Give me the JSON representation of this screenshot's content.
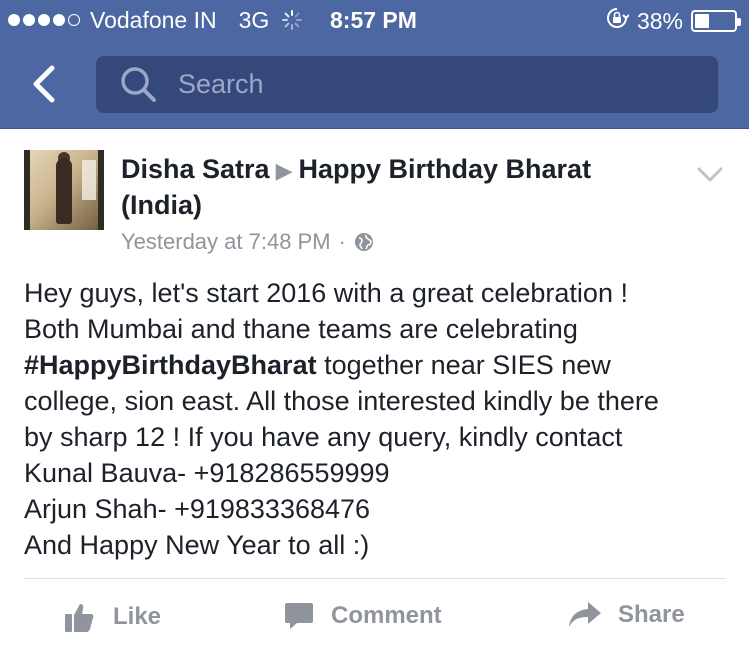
{
  "status_bar": {
    "carrier": "Vodafone IN",
    "network": "3G",
    "time": "8:57 PM",
    "battery_percent": "38%",
    "battery_level": 0.38,
    "signal_bars": 4
  },
  "nav": {
    "back_icon": "chevron-left-icon",
    "search_icon": "search-icon",
    "search_placeholder": "Search",
    "search_value": ""
  },
  "post": {
    "author": "Disha Satra",
    "target": "Happy Birthday Bharat (India)",
    "timestamp": "Yesterday at 7:48 PM",
    "separator": "·",
    "privacy_icon": "globe-icon",
    "menu_icon": "chevron-down-icon",
    "body": {
      "line1": "Hey guys, let's start 2016 with a great celebration !",
      "line2": "Both Mumbai and thane teams are celebrating",
      "hashtag": "#HappyBirthdayBharat",
      "line3_rest": " together near SIES new",
      "line4": "college, sion east. All those interested kindly be there",
      "line5": "by sharp 12 ! If you have any query, kindly contact",
      "line6": "Kunal Bauva- +918286559999",
      "line7": "Arjun Shah- +919833368476",
      "line8": "And Happy New Year to all :)"
    }
  },
  "actions": {
    "like_label": "Like",
    "comment_label": "Comment",
    "share_label": "Share"
  },
  "colors": {
    "header_bg": "#4c67a1",
    "search_bg": "#35487b",
    "muted_text": "#90949c",
    "body_text": "#1d2129"
  }
}
